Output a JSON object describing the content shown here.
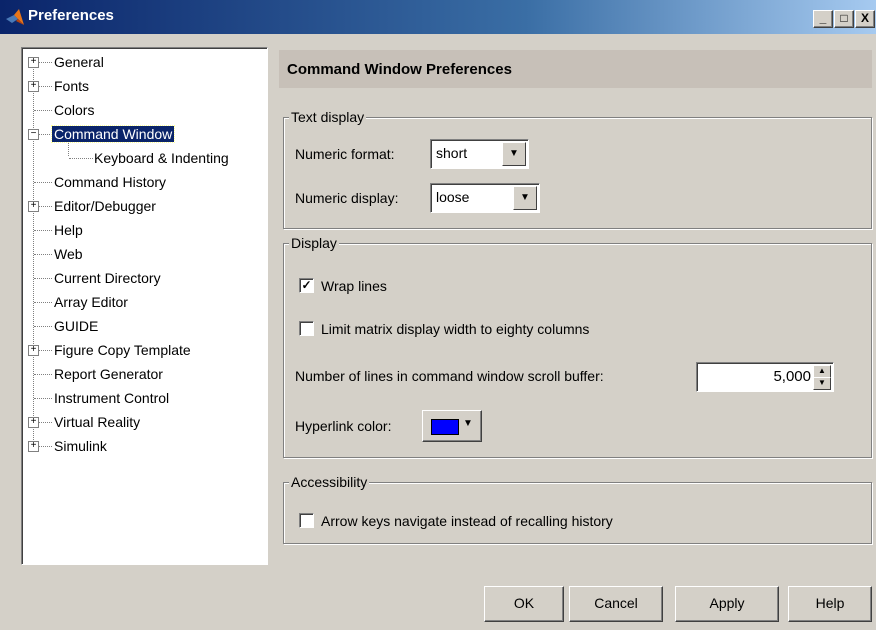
{
  "window": {
    "title": "Preferences",
    "minimize": "_",
    "maximize": "□",
    "close": "X"
  },
  "tree": {
    "items": [
      {
        "label": "General",
        "expander": "+"
      },
      {
        "label": "Fonts",
        "expander": "+"
      },
      {
        "label": "Colors"
      },
      {
        "label": "Command Window",
        "expander": "−",
        "selected": true
      },
      {
        "label": "Keyboard & Indenting"
      },
      {
        "label": "Command History"
      },
      {
        "label": "Editor/Debugger",
        "expander": "+"
      },
      {
        "label": "Help"
      },
      {
        "label": "Web"
      },
      {
        "label": "Current Directory"
      },
      {
        "label": "Array Editor"
      },
      {
        "label": "GUIDE"
      },
      {
        "label": "Figure Copy Template",
        "expander": "+"
      },
      {
        "label": "Report Generator"
      },
      {
        "label": "Instrument Control"
      },
      {
        "label": "Virtual Reality",
        "expander": "+"
      },
      {
        "label": "Simulink",
        "expander": "+"
      }
    ]
  },
  "panel": {
    "header": "Command Window Preferences",
    "text_display": {
      "legend": "Text display",
      "numeric_format_label": "Numeric format:",
      "numeric_format_value": "short",
      "numeric_display_label": "Numeric display:",
      "numeric_display_value": "loose"
    },
    "display": {
      "legend": "Display",
      "wrap_lines_label": "Wrap lines",
      "wrap_lines_checked": true,
      "limit_width_label": "Limit matrix display width to eighty columns",
      "limit_width_checked": false,
      "scroll_buffer_label": "Number of lines in command window scroll buffer:",
      "scroll_buffer_value": "5,000",
      "hyperlink_color_label": "Hyperlink color:",
      "hyperlink_color": "#0000ff"
    },
    "accessibility": {
      "legend": "Accessibility",
      "arrow_keys_label": "Arrow keys navigate instead of recalling history",
      "arrow_keys_checked": false
    }
  },
  "buttons": {
    "ok": "OK",
    "cancel": "Cancel",
    "apply": "Apply",
    "help": "Help"
  },
  "glyphs": {
    "check": "✓",
    "dropdown": "▼",
    "spin_up": "▲",
    "spin_down": "▼"
  }
}
